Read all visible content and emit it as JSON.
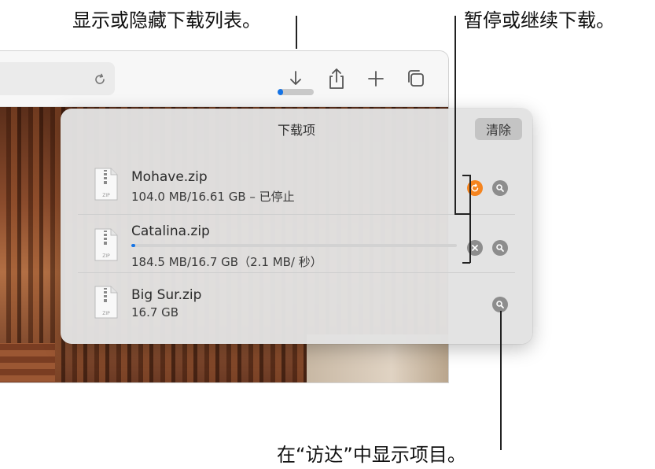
{
  "callouts": {
    "show_hide": "显示或隐藏下载列表。",
    "pause_resume": "暂停或继续下载。",
    "show_in_finder": "在“访达”中显示项目。"
  },
  "toolbar": {
    "icons": [
      "reload-icon",
      "downloads-icon",
      "share-icon",
      "new-tab-icon",
      "tab-overview-icon"
    ],
    "download_progress": 0.15
  },
  "downloads": {
    "title": "下载项",
    "clear_label": "清除",
    "items": [
      {
        "name": "Mohave.zip",
        "status": "104.0 MB/16.61 GB – 已停止",
        "icon_label": "ZIP",
        "action": "resume",
        "progress": 0.006
      },
      {
        "name": "Catalina.zip",
        "status": "184.5 MB/16.7 GB（2.1 MB/ 秒）",
        "icon_label": "ZIP",
        "action": "cancel",
        "progress": 0.011
      },
      {
        "name": "Big Sur.zip",
        "status": "16.7 GB",
        "icon_label": "ZIP",
        "action": "none"
      }
    ]
  },
  "colors": {
    "accent_blue": "#1473e6",
    "resume_orange": "#f5841f",
    "button_gray": "#8d8d8d"
  }
}
